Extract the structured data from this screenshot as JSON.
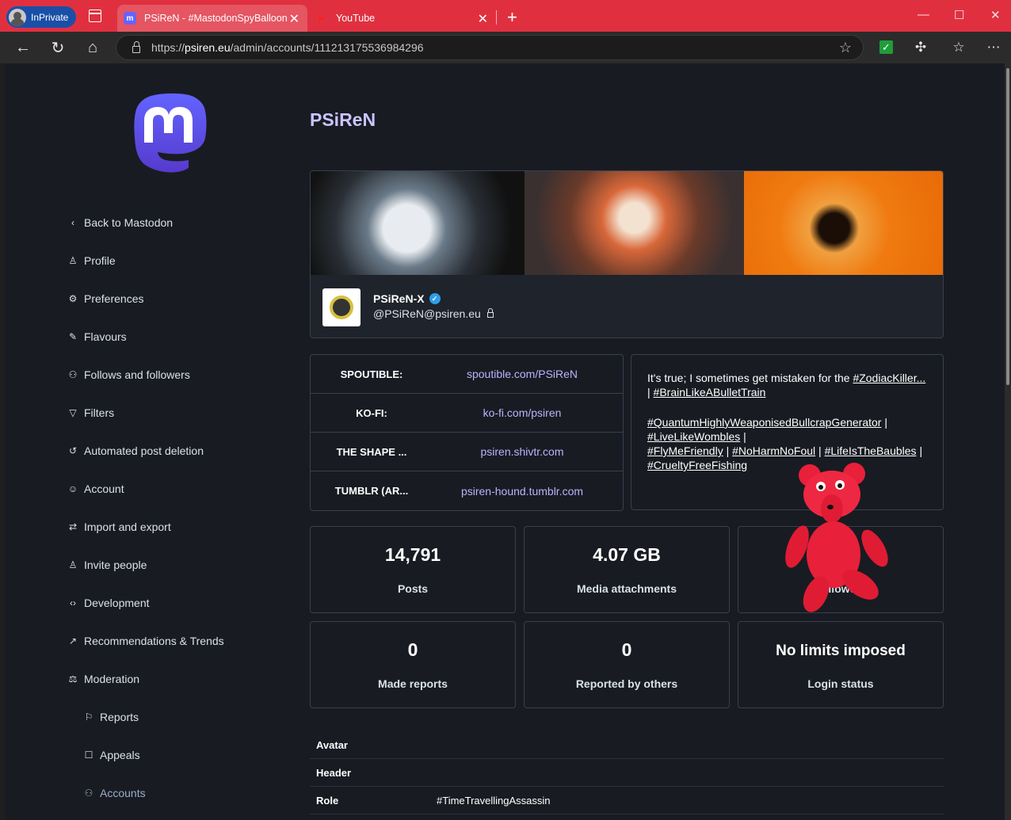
{
  "browser": {
    "inprivate_label": "InPrivate",
    "tabs": [
      {
        "title": "PSiReN - #MastodonSpyBalloon",
        "active": true
      },
      {
        "title": "YouTube",
        "active": false
      }
    ],
    "url_prefix": "https://",
    "url_host": "psiren.eu",
    "url_path": "/admin/accounts/111213175536984296"
  },
  "sidebar": {
    "items": [
      {
        "label": "Back to Mastodon",
        "icon": "chevron-left-icon"
      },
      {
        "label": "Profile",
        "icon": "user-icon"
      },
      {
        "label": "Preferences",
        "icon": "gear-icon"
      },
      {
        "label": "Flavours",
        "icon": "brush-icon"
      },
      {
        "label": "Follows and followers",
        "icon": "users-icon"
      },
      {
        "label": "Filters",
        "icon": "filter-icon"
      },
      {
        "label": "Automated post deletion",
        "icon": "history-icon"
      },
      {
        "label": "Account",
        "icon": "user-circle-icon"
      },
      {
        "label": "Import and export",
        "icon": "exchange-icon"
      },
      {
        "label": "Invite people",
        "icon": "user-plus-icon"
      },
      {
        "label": "Development",
        "icon": "code-icon"
      },
      {
        "label": "Recommendations & Trends",
        "icon": "trend-icon"
      },
      {
        "label": "Moderation",
        "icon": "gavel-icon"
      }
    ],
    "subitems": [
      {
        "label": "Reports",
        "icon": "flag-icon"
      },
      {
        "label": "Appeals",
        "icon": "comment-icon"
      },
      {
        "label": "Accounts",
        "icon": "users-icon"
      }
    ]
  },
  "main": {
    "title": "PSiReN",
    "profile": {
      "display_name": "PSiReN-X",
      "handle": "@PSiReN@psiren.eu"
    },
    "fields": [
      {
        "key": "SPOUTIBLE:",
        "value": "spoutible.com/PSiReN"
      },
      {
        "key": "KO-FI:",
        "value": "ko-fi.com/psiren"
      },
      {
        "key": "THE SHAPE ...",
        "value": "psiren.shivtr.com"
      },
      {
        "key": "TUMBLR (AR...",
        "value": "psiren-hound.tumblr.com"
      }
    ],
    "bio": {
      "line1_text": "It's true; I sometimes get mistaken for the ",
      "line1_tag": "#ZodiacKiller...",
      "line2_sep": "| ",
      "line2_tag": "#BrainLikeABulletTrain",
      "tag3": "#QuantumHighlyWeaponisedBullcrapGenerator",
      "tag4": "#LiveLikeWombles",
      "tag5": "#FlyMeFriendly",
      "tag6": "#NoHarmNoFoul",
      "tag7": "#LifeIsTheBaubles",
      "tag8": "#CrueltyFreeFishing",
      "sep": " | "
    },
    "stats": [
      {
        "value": "14,791",
        "label": "Posts"
      },
      {
        "value": "4.07 GB",
        "label": "Media attachments"
      },
      {
        "value": "",
        "label": "Followers"
      },
      {
        "value": "0",
        "label": "Made reports"
      },
      {
        "value": "0",
        "label": "Reported by others"
      },
      {
        "value": "No limits imposed",
        "label": "Login status"
      }
    ],
    "table": [
      {
        "key": "Avatar",
        "value": ""
      },
      {
        "key": "Header",
        "value": ""
      },
      {
        "key": "Role",
        "value": "#TimeTravellingAssassin"
      }
    ]
  }
}
